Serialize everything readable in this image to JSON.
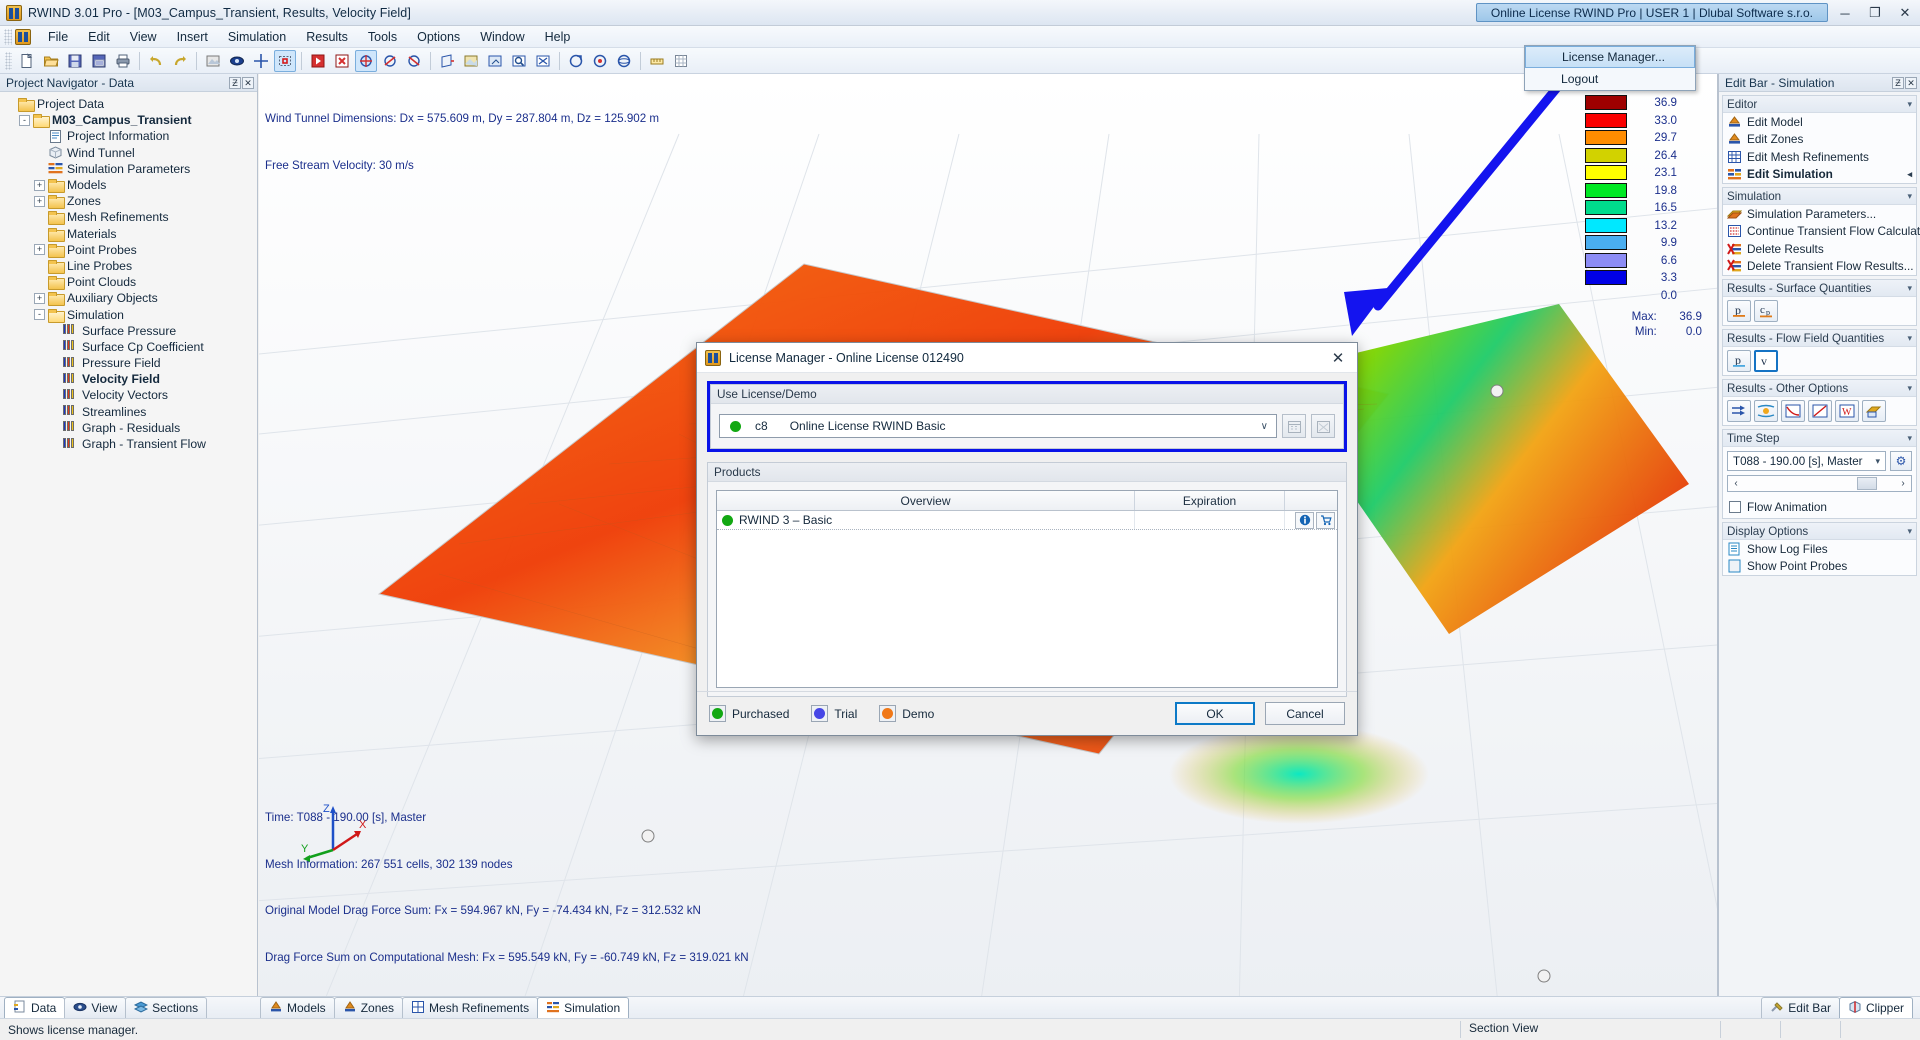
{
  "window": {
    "title": "RWIND 3.01 Pro - [M03_Campus_Transient, Results, Velocity Field]",
    "license_button": "Online License RWIND Pro | USER 1 | Dlubal Software s.r.o.",
    "minimize": "─",
    "restore": "❐",
    "close": "✕"
  },
  "menubar": {
    "items": [
      "File",
      "Edit",
      "View",
      "Insert",
      "Simulation",
      "Results",
      "Tools",
      "Options",
      "Window",
      "Help"
    ]
  },
  "license_menu": {
    "items": [
      "License Manager...",
      "Logout"
    ]
  },
  "navigator": {
    "caption": "Project Navigator - Data",
    "pin_glyph": "Ƶ",
    "close_glyph": "✕",
    "tree": [
      {
        "label": "Project Data",
        "depth": 0,
        "expander": "",
        "icon": "folder",
        "bold": false
      },
      {
        "label": "M03_Campus_Transient",
        "depth": 1,
        "expander": "-",
        "icon": "folder-open",
        "bold": true
      },
      {
        "label": "Project Information",
        "depth": 2,
        "expander": "",
        "icon": "doc",
        "bold": false
      },
      {
        "label": "Wind Tunnel",
        "depth": 2,
        "expander": "",
        "icon": "cube",
        "bold": false
      },
      {
        "label": "Simulation Parameters",
        "depth": 2,
        "expander": "",
        "icon": "params",
        "bold": false
      },
      {
        "label": "Models",
        "depth": 2,
        "expander": "+",
        "icon": "folder",
        "bold": false
      },
      {
        "label": "Zones",
        "depth": 2,
        "expander": "+",
        "icon": "folder",
        "bold": false
      },
      {
        "label": "Mesh Refinements",
        "depth": 2,
        "expander": "",
        "icon": "folder",
        "bold": false
      },
      {
        "label": "Materials",
        "depth": 2,
        "expander": "",
        "icon": "folder",
        "bold": false
      },
      {
        "label": "Point Probes",
        "depth": 2,
        "expander": "+",
        "icon": "folder",
        "bold": false
      },
      {
        "label": "Line Probes",
        "depth": 2,
        "expander": "",
        "icon": "folder",
        "bold": false
      },
      {
        "label": "Point Clouds",
        "depth": 2,
        "expander": "",
        "icon": "folder",
        "bold": false
      },
      {
        "label": "Auxiliary Objects",
        "depth": 2,
        "expander": "+",
        "icon": "folder",
        "bold": false
      },
      {
        "label": "Simulation",
        "depth": 2,
        "expander": "-",
        "icon": "folder-open",
        "bold": false
      },
      {
        "label": "Surface Pressure",
        "depth": 3,
        "expander": "",
        "icon": "legend",
        "bold": false
      },
      {
        "label": "Surface Cp Coefficient",
        "depth": 3,
        "expander": "",
        "icon": "legend",
        "bold": false
      },
      {
        "label": "Pressure Field",
        "depth": 3,
        "expander": "",
        "icon": "legend",
        "bold": false
      },
      {
        "label": "Velocity Field",
        "depth": 3,
        "expander": "",
        "icon": "legend",
        "bold": true
      },
      {
        "label": "Velocity Vectors",
        "depth": 3,
        "expander": "",
        "icon": "legend",
        "bold": false
      },
      {
        "label": "Streamlines",
        "depth": 3,
        "expander": "",
        "icon": "legend",
        "bold": false
      },
      {
        "label": "Graph - Residuals",
        "depth": 3,
        "expander": "",
        "icon": "legend",
        "bold": false
      },
      {
        "label": "Graph - Transient Flow",
        "depth": 3,
        "expander": "",
        "icon": "legend",
        "bold": false
      }
    ]
  },
  "viewport": {
    "top_info_line1": "Wind Tunnel Dimensions: Dx = 575.609 m, Dy = 287.804 m, Dz = 125.902 m",
    "top_info_line2": "Free Stream Velocity: 30 m/s",
    "bottom_info": [
      "Time: T088 - 190.00 [s], Master",
      "Mesh Information: 267 551 cells, 302 139 nodes",
      "Original Model Drag Force Sum: Fx = 594.967 kN, Fy = -74.434 kN, Fz = 312.532 kN",
      "Drag Force Sum on Computational Mesh: Fx = 595.549 kN, Fy = -60.749 kN, Fz = 319.021 kN"
    ],
    "axes": {
      "x": "X",
      "y": "Y",
      "z": "Z"
    },
    "legend": {
      "values": [
        "36.9",
        "33.0",
        "29.7",
        "26.4",
        "23.1",
        "19.8",
        "16.5",
        "13.2",
        "9.9",
        "6.6",
        "3.3",
        "0.0"
      ],
      "colors": [
        "#9e0000",
        "#fa0000",
        "#ff8c00",
        "#d2d200",
        "#ffff00",
        "#00e824",
        "#00dc8c",
        "#00e8ff",
        "#4aaef0",
        "#8c8cf5",
        "#0000e6"
      ],
      "max_label": "Max:",
      "max_value": "36.9",
      "min_label": "Min:",
      "min_value": "0.0"
    }
  },
  "editbar": {
    "caption": "Edit Bar - Simulation",
    "pin_glyph": "Ƶ",
    "close_glyph": "✕",
    "groups": [
      {
        "title": "Editor",
        "items": [
          {
            "label": "Edit Model",
            "icon": "model-icon",
            "bold": false,
            "arrow": false
          },
          {
            "label": "Edit Zones",
            "icon": "zones-icon",
            "bold": false,
            "arrow": false
          },
          {
            "label": "Edit Mesh Refinements",
            "icon": "mesh-icon",
            "bold": false,
            "arrow": false
          },
          {
            "label": "Edit Simulation",
            "icon": "simulation-icon",
            "bold": true,
            "arrow": true
          }
        ]
      },
      {
        "title": "Simulation",
        "items": [
          {
            "label": "Simulation Parameters...",
            "icon": "params-icon",
            "bold": false,
            "arrow": false
          },
          {
            "label": "Continue Transient Flow Calculat...",
            "icon": "continue-icon",
            "bold": false,
            "arrow": false
          },
          {
            "label": "Delete Results",
            "icon": "delete-results-icon",
            "bold": false,
            "arrow": false
          },
          {
            "label": "Delete Transient Flow Results...",
            "icon": "delete-transient-icon",
            "bold": false,
            "arrow": false
          }
        ]
      }
    ],
    "surface_quantities": {
      "title": "Results - Surface Quantities",
      "buttons": [
        "p",
        "cp"
      ]
    },
    "flow_quantities": {
      "title": "Results - Flow Field Quantities",
      "buttons": [
        "p",
        "v"
      ],
      "selected": "v"
    },
    "other_options": {
      "title": "Results - Other Options",
      "buttons": [
        "vectors-icon",
        "streamlines-icon",
        "graph-residuals-icon",
        "graph-transient-icon",
        "wind-icon",
        "render-icon"
      ]
    },
    "time_step": {
      "title": "Time Step",
      "value": "T088 - 190.00 [s], Master",
      "settings_glyph": "⚙",
      "prev_glyph": "‹",
      "next_glyph": "›",
      "flow_animation_label": "Flow Animation"
    },
    "display_options": {
      "title": "Display Options",
      "items": [
        "Show Log Files",
        "Show Point Probes"
      ]
    }
  },
  "bottom_tabs": {
    "left": [
      {
        "label": "Data",
        "active": true
      },
      {
        "label": "View",
        "active": false
      },
      {
        "label": "Sections",
        "active": false
      }
    ],
    "center": [
      {
        "label": "Models",
        "active": false
      },
      {
        "label": "Zones",
        "active": false
      },
      {
        "label": "Mesh Refinements",
        "active": false
      },
      {
        "label": "Simulation",
        "active": true
      }
    ],
    "right": [
      {
        "label": "Edit Bar",
        "active": false
      },
      {
        "label": "Clipper",
        "active": true
      }
    ]
  },
  "statusbar": {
    "message": "Shows license manager.",
    "section_view": "Section View"
  },
  "dialog": {
    "title": "License Manager - Online License 012490",
    "close_glyph": "✕",
    "use_license_group": "Use License/Demo",
    "selected_license": {
      "code": "c8",
      "name": "Online License RWIND Basic",
      "status_color": "#12a812",
      "arrow": "∨"
    },
    "products_group": "Products",
    "table": {
      "columns": [
        "Overview",
        "Expiration",
        ""
      ],
      "rows": [
        {
          "name": "RWIND 3 – Basic",
          "expiration": "",
          "status_color": "#12a812",
          "info_glyph": "ℹ",
          "cart_glyph": "🛒"
        }
      ]
    },
    "status_legend": [
      {
        "label": "Purchased",
        "color": "#12a812"
      },
      {
        "label": "Trial",
        "color": "#4646e6"
      },
      {
        "label": "Demo",
        "color": "#f07818"
      }
    ],
    "ok_label": "OK",
    "cancel_label": "Cancel"
  }
}
